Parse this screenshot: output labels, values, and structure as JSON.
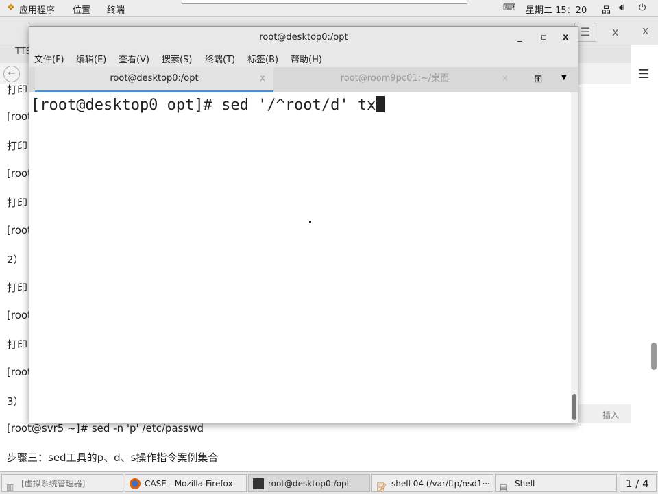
{
  "topbar": {
    "apps": "应用程序",
    "places": "位置",
    "terminal": "终端",
    "clock": "星期二 15：20"
  },
  "background_window": {
    "tab_fragment": "TTS",
    "status_insert": "插入",
    "lines": [
      "打印",
      "[root",
      "打印",
      "[root",
      "打印",
      "[root",
      "2）",
      "打印",
      "[root",
      "打印",
      "[root",
      "3）",
      "[root@svr5 ~]# sed -n 'p' /etc/passwd",
      "步骤三：sed工具的p、d、s操作指令案例集合"
    ]
  },
  "terminal": {
    "title": "root@desktop0:/opt",
    "menu": [
      "文件(F)",
      "编辑(E)",
      "查看(V)",
      "搜索(S)",
      "终端(T)",
      "标签(B)",
      "帮助(H)"
    ],
    "tabs": [
      {
        "label": "root@desktop0:/opt",
        "active": true
      },
      {
        "label": "root@room9pc01:~/桌面",
        "active": false
      }
    ],
    "prompt": "[root@desktop0 opt]# ",
    "command": "sed '/^root/d' tx"
  },
  "taskbar": {
    "items": [
      "[虚拟系统管理器]",
      "CASE - Mozilla Firefox",
      "root@desktop0:/opt",
      "shell 04 (/var/ftp/nsd1···",
      "Shell"
    ],
    "workspace": "1 / 4"
  },
  "colors": {
    "active_tab_underline": "#4a90d9"
  }
}
